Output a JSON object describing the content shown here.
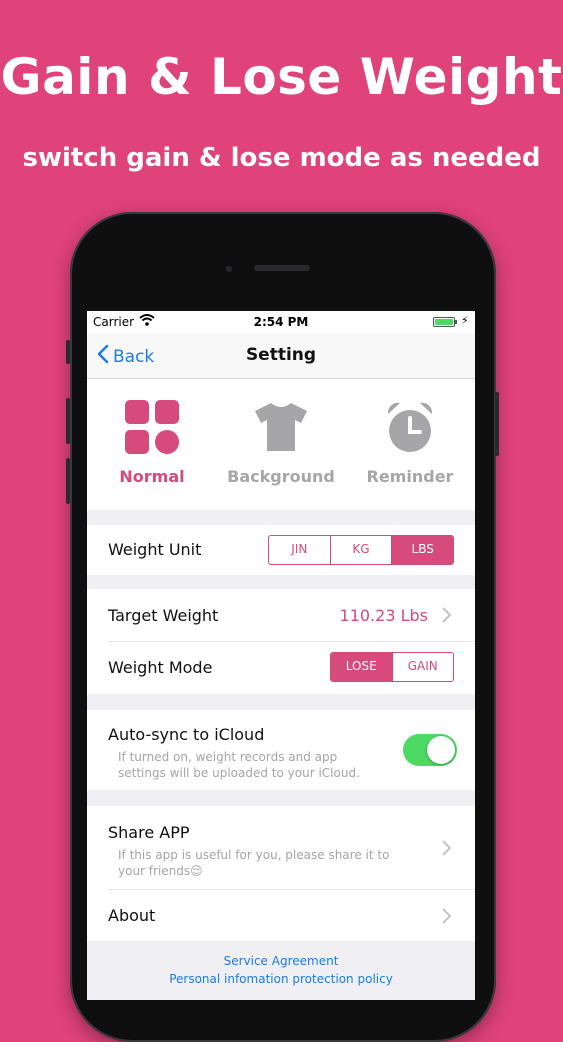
{
  "promo": {
    "headline": "Gain & Lose Weight",
    "subline": "switch gain & lose mode as needed"
  },
  "status_bar": {
    "carrier": "Carrier",
    "time": "2:54 PM"
  },
  "nav": {
    "back_label": "Back",
    "title": "Setting"
  },
  "modes": [
    {
      "label": "Normal",
      "icon": "grid-icon",
      "active": true
    },
    {
      "label": "Background",
      "icon": "tshirt-icon",
      "active": false
    },
    {
      "label": "Reminder",
      "icon": "alarm-clock-icon",
      "active": false
    }
  ],
  "settings": {
    "weight_unit": {
      "label": "Weight Unit",
      "options": [
        "JIN",
        "KG",
        "LBS"
      ],
      "selected": "LBS"
    },
    "target_weight": {
      "label": "Target Weight",
      "value": "110.23 Lbs"
    },
    "weight_mode": {
      "label": "Weight Mode",
      "options": [
        "LOSE",
        "GAIN"
      ],
      "selected": "LOSE"
    },
    "auto_sync": {
      "label": "Auto-sync to iCloud",
      "description_line1": "If turned on, weight records and app",
      "description_line2": "settings will be uploaded to your iCloud.",
      "enabled": true
    },
    "share_app": {
      "label": "Share APP",
      "description_line1": "If this app is useful for you, please share it to",
      "description_line2": "your friends😌"
    },
    "about": {
      "label": "About"
    }
  },
  "footer_links": {
    "service_agreement": "Service Agreement",
    "privacy_policy": "Personal infomation protection policy"
  },
  "colors": {
    "background": "#e0427a",
    "accent": "#d74a7c",
    "inactive": "#a6a6a8",
    "link": "#1a7ce6",
    "toggle_on": "#4cd964"
  }
}
